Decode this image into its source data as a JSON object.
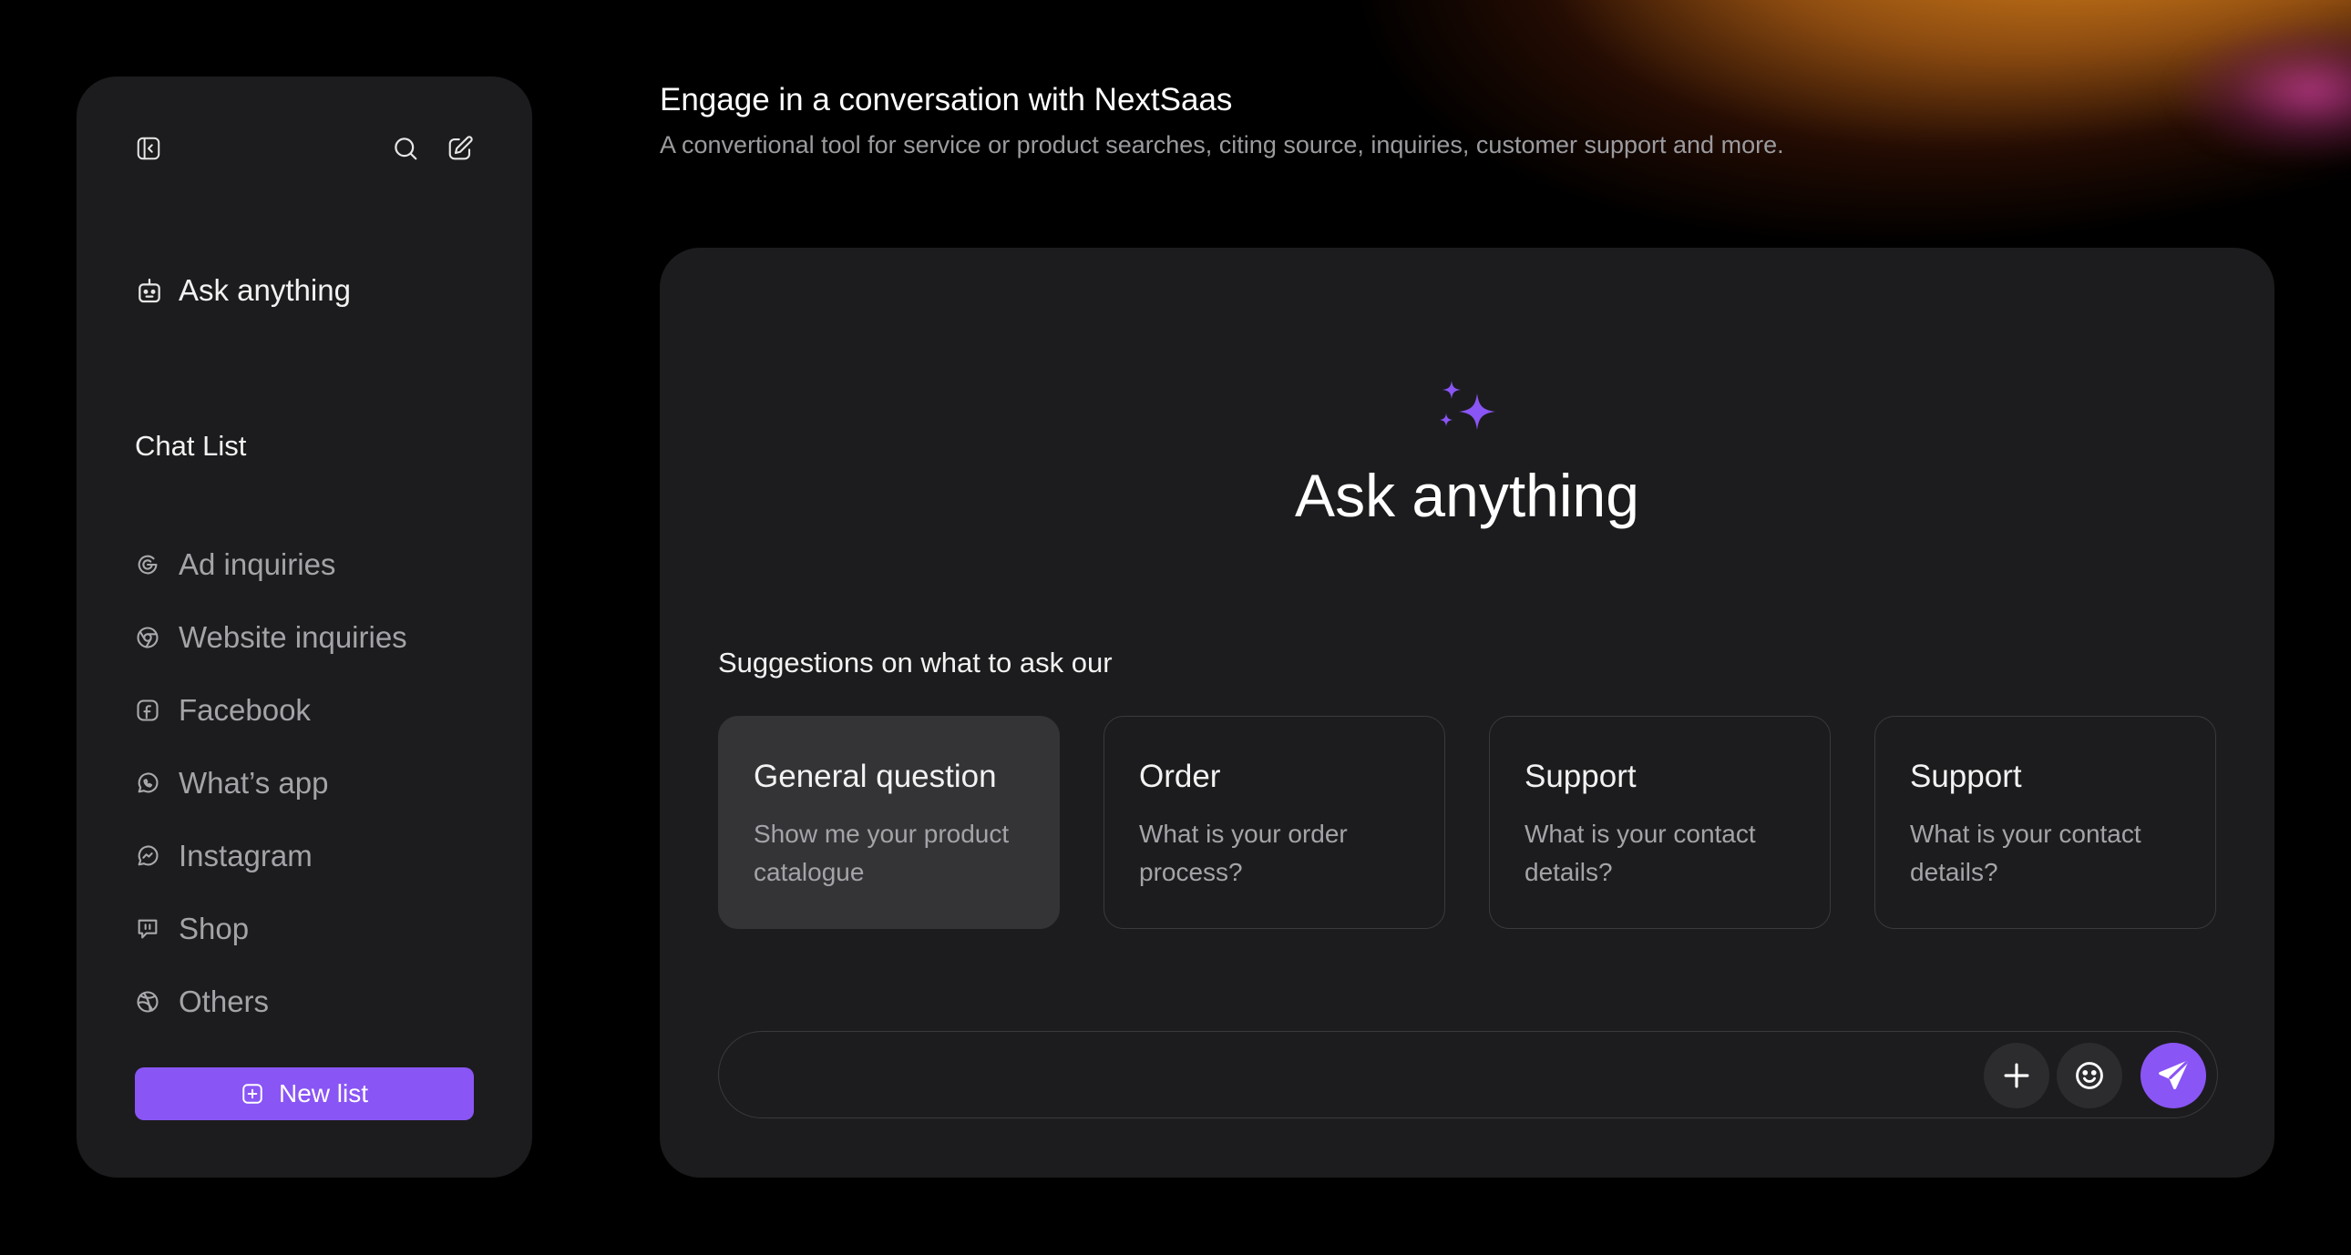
{
  "header": {
    "title": "Engage in a conversation with NextSaas",
    "subtitle": "A convertional tool for service or product searches, citing source, inquiries, customer support and more."
  },
  "sidebar": {
    "ask_label": "Ask anything",
    "chat_list_title": "Chat List",
    "items": [
      {
        "label": "Ad inquiries",
        "icon": "google-icon"
      },
      {
        "label": "Website inquiries",
        "icon": "chrome-icon"
      },
      {
        "label": "Facebook",
        "icon": "facebook-icon"
      },
      {
        "label": "What’s app",
        "icon": "whatsapp-icon"
      },
      {
        "label": "Instagram",
        "icon": "messenger-icon"
      },
      {
        "label": "Shop",
        "icon": "shop-icon"
      },
      {
        "label": "Others",
        "icon": "dribbble-icon"
      }
    ],
    "new_list_label": "New list"
  },
  "main": {
    "title": "Ask anything",
    "suggestions_title": "Suggestions on what to ask our",
    "suggestions": [
      {
        "heading": "General question",
        "description": "Show me your product catalogue"
      },
      {
        "heading": "Order",
        "description": "What is your order process?"
      },
      {
        "heading": "Support",
        "description": "What is your contact details?"
      },
      {
        "heading": "Support",
        "description": "What is your contact details?"
      }
    ],
    "composer": {
      "placeholder": ""
    }
  },
  "colors": {
    "accent": "#8a55f5",
    "panel": "#1c1c1e",
    "background": "#000000"
  }
}
